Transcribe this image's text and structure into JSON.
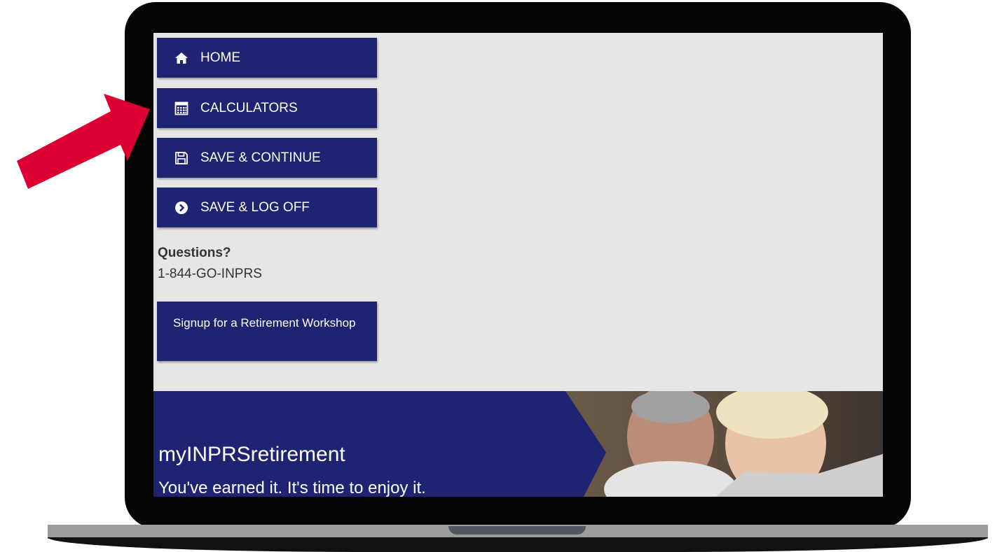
{
  "nav": {
    "home_label": "HOME",
    "calculators_label": "CALCULATORS",
    "save_continue_label": "SAVE & CONTINUE",
    "save_logoff_label": "SAVE & LOG OFF"
  },
  "questions": {
    "title": "Questions?",
    "phone": "1-844-GO-INPRS"
  },
  "workshop_label": "Signup for a Retirement Workshop",
  "hero": {
    "title": "myINPRSretirement",
    "tagline": "You've earned it. It's time to enjoy it."
  },
  "colors": {
    "brand_navy": "#1e2472",
    "screen_bg": "#e6e6e6",
    "arrow_red": "#dc0032"
  },
  "icons": [
    "home-icon",
    "calculator-icon",
    "floppy-disk-icon",
    "chevron-circle-right-icon"
  ]
}
